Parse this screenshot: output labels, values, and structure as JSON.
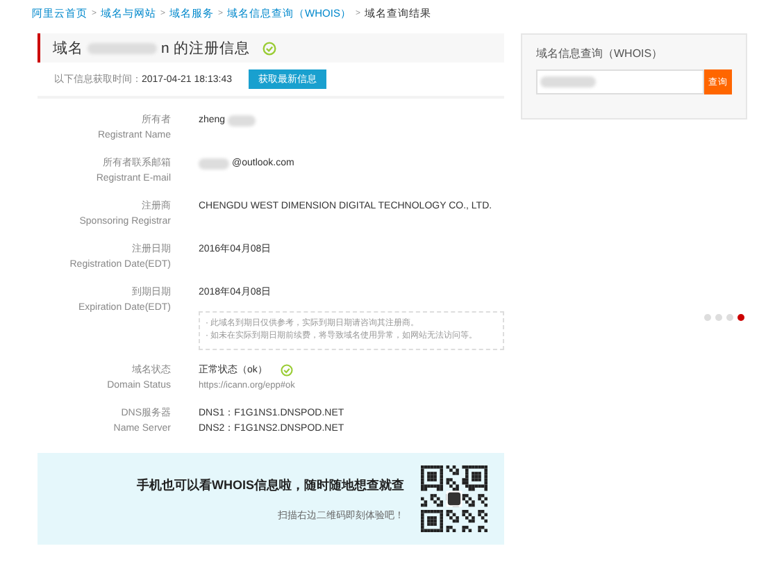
{
  "breadcrumb_separator": ">",
  "breadcrumb": [
    {
      "label": "阿里云首页",
      "link": true
    },
    {
      "label": "域名与网站",
      "link": true
    },
    {
      "label": "域名服务",
      "link": true
    },
    {
      "label": "域名信息查询（WHOIS）",
      "link": true
    },
    {
      "label": "域名查询结果",
      "link": false
    }
  ],
  "header": {
    "prefix": "域名",
    "suffix": "n 的注册信息",
    "redacted": true
  },
  "fetch": {
    "label": "以下信息获取时间：",
    "time": "2017-04-21 18:13:43",
    "button": "获取最新信息"
  },
  "fields": [
    {
      "label": "所有者",
      "label_en": "Registrant Name",
      "values": [
        "zheng"
      ],
      "redacted_after": true
    },
    {
      "label": "所有者联系邮箱",
      "label_en": "Registrant E-mail",
      "values": [
        "@outlook.com"
      ],
      "redacted_before": true
    },
    {
      "label": "注册商",
      "label_en": "Sponsoring Registrar",
      "values": [
        "CHENGDU WEST DIMENSION DIGITAL TECHNOLOGY CO., LTD."
      ]
    },
    {
      "label": "注册日期",
      "label_en": "Registration Date(EDT)",
      "values": [
        "2016年04月08日"
      ]
    },
    {
      "label": "到期日期",
      "label_en": "Expiration Date(EDT)",
      "values": [
        "2018年04月08日"
      ],
      "notes": [
        "· 此域名到期日仅供参考，实际到期日期请咨询其注册商。",
        "· 如未在实际到期日期前续费，将导致域名使用异常，如网站无法访问等。"
      ]
    },
    {
      "label": "域名状态",
      "label_en": "Domain Status",
      "values": [
        "正常状态（ok）"
      ],
      "link": "https://icann.org/epp#ok",
      "ok": true
    },
    {
      "label": "DNS服务器",
      "label_en": "Name Server",
      "values": [
        "DNS1：F1G1NS1.DNSPOD.NET",
        "DNS2：F1G1NS2.DNSPOD.NET"
      ]
    }
  ],
  "banner": {
    "title": "手机也可以看WHOIS信息啦，随时随地想查就查",
    "subtitle": "扫描右边二维码即刻体验吧！"
  },
  "side": {
    "title": "域名信息查询（WHOIS）",
    "redacted": true,
    "button": "查询"
  },
  "dots": [
    {
      "selected": false
    },
    {
      "selected": false
    },
    {
      "selected": false
    },
    {
      "selected": true
    }
  ]
}
